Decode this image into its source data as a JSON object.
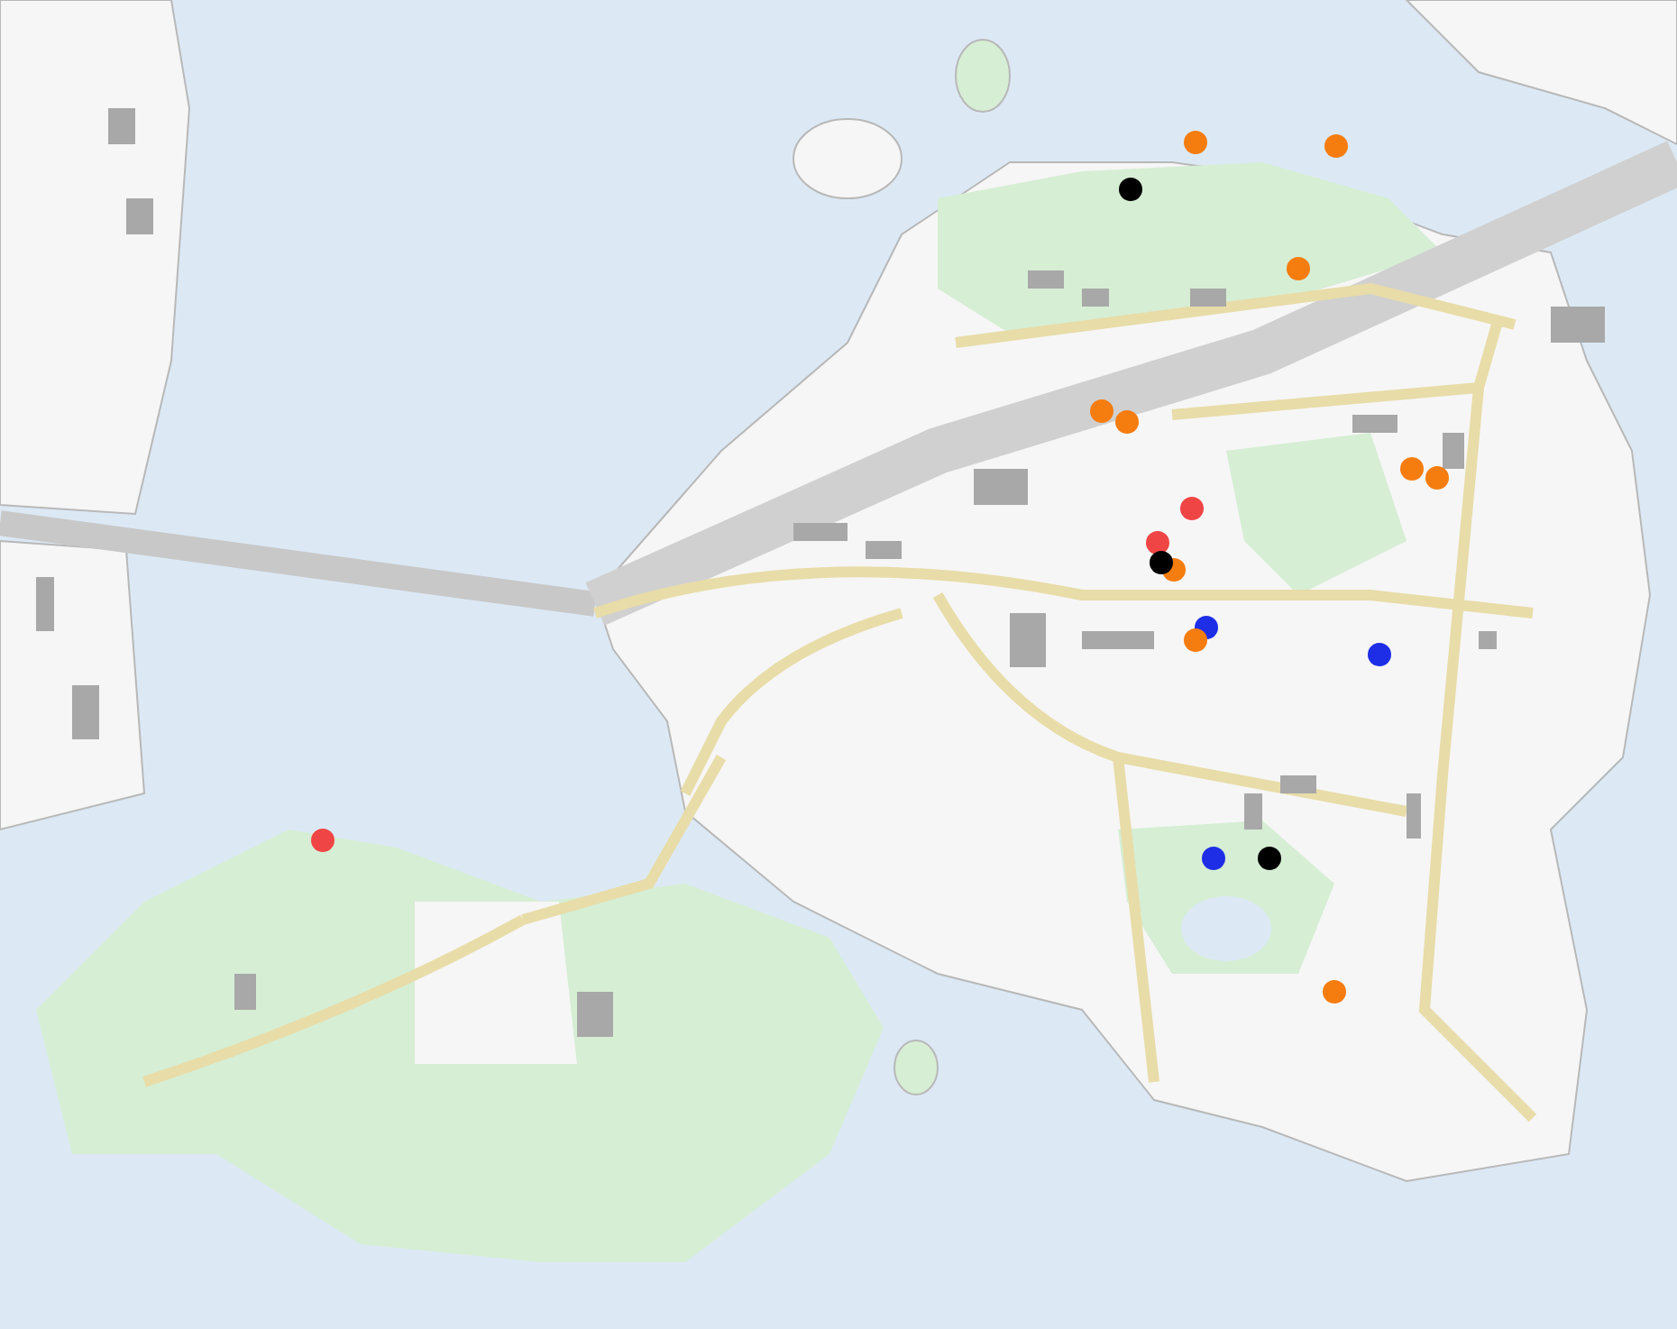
{
  "map": {
    "pins": [
      {
        "color": "#000000"
      },
      {
        "color": "#f57c0f"
      },
      {
        "color": "#f57c0f"
      },
      {
        "color": "#f57c0f"
      },
      {
        "color": "#f57c0f"
      },
      {
        "color": "#f57c0f"
      },
      {
        "color": "#f04545"
      },
      {
        "color": "#f57c0f"
      },
      {
        "color": "#f57c0f"
      },
      {
        "color": "#f04545"
      },
      {
        "color": "#f57c0f"
      },
      {
        "color": "#000000"
      },
      {
        "color": "#1e2ee6"
      },
      {
        "color": "#f57c0f"
      },
      {
        "color": "#1e2ee6"
      },
      {
        "color": "#f04545"
      },
      {
        "color": "#1e2ee6"
      },
      {
        "color": "#000000"
      },
      {
        "color": "#f57c0f"
      }
    ]
  }
}
